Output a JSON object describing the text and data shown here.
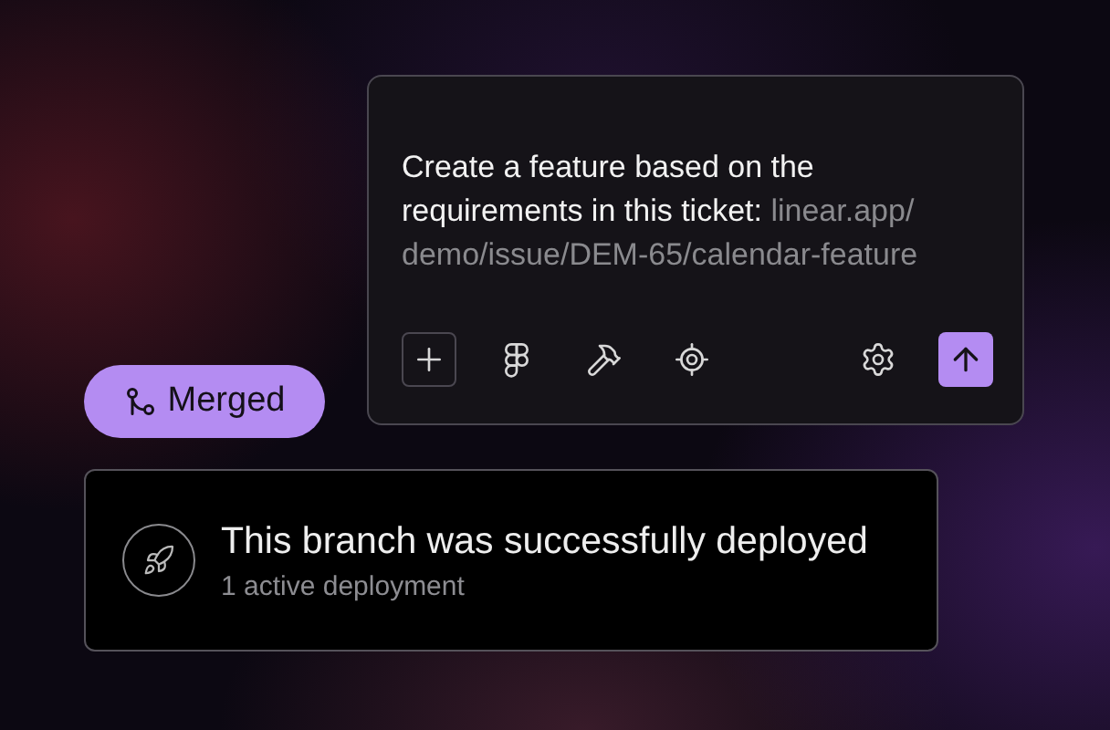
{
  "composer": {
    "text": "Create a feature based on the requirements in this ticket: ",
    "url": "linear.app/demo/issue/DEM-65/calendar-feature"
  },
  "status_badge": {
    "label": "Merged"
  },
  "deployment": {
    "title": "This branch was successfully deployed",
    "subtitle": "1 active deployment"
  }
}
